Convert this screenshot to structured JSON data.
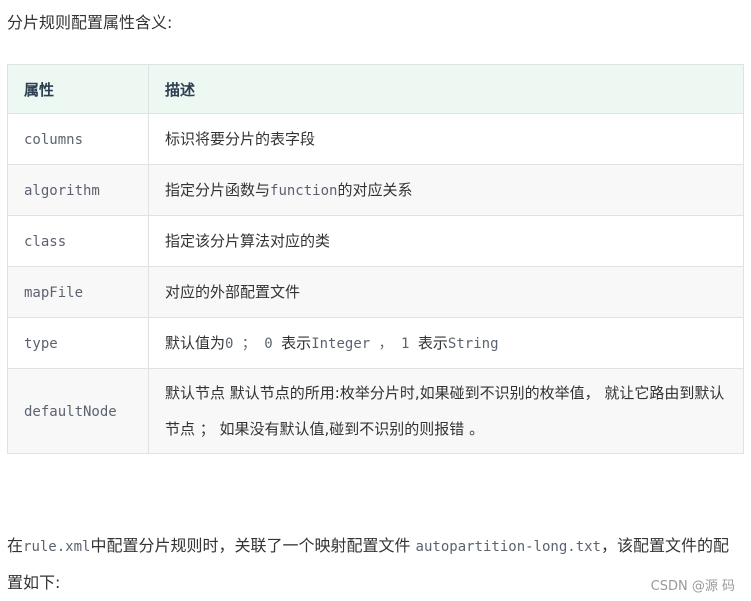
{
  "intro_text": "分片规则配置属性含义:",
  "table": {
    "headers": [
      "属性",
      "描述"
    ],
    "rows": [
      {
        "prop": "columns",
        "desc": [
          {
            "t": "标识将要分片的表字段",
            "mono": false
          }
        ]
      },
      {
        "prop": "algorithm",
        "desc": [
          {
            "t": "指定分片函数与",
            "mono": false
          },
          {
            "t": "function",
            "mono": true
          },
          {
            "t": "的对应关系",
            "mono": false
          }
        ]
      },
      {
        "prop": "class",
        "desc": [
          {
            "t": "指定该分片算法对应的类",
            "mono": false
          }
        ]
      },
      {
        "prop": "mapFile",
        "desc": [
          {
            "t": "对应的外部配置文件",
            "mono": false
          }
        ]
      },
      {
        "prop": "type",
        "desc": [
          {
            "t": "默认值为",
            "mono": false
          },
          {
            "t": "0 ； 0 ",
            "mono": true
          },
          {
            "t": "表示",
            "mono": false
          },
          {
            "t": "Integer ， 1 ",
            "mono": true
          },
          {
            "t": "表示",
            "mono": false
          },
          {
            "t": "String",
            "mono": true
          }
        ]
      },
      {
        "prop": "defaultNode",
        "desc": [
          {
            "t": "默认节点  默认节点的所用:枚举分片时,如果碰到不识别的枚举值， 就让它路由到默认节点 ； 如果没有默认值,碰到不识别的则报错  。",
            "mono": false
          }
        ]
      }
    ]
  },
  "outro": {
    "p1": "在",
    "file1": "rule.xml",
    "p2": "中配置分片规则时，关联了一个映射配置文件 ",
    "file2": "autopartition-long.txt",
    "p3": "，该配置文件的配置如下:"
  },
  "watermark": "CSDN @源  码"
}
